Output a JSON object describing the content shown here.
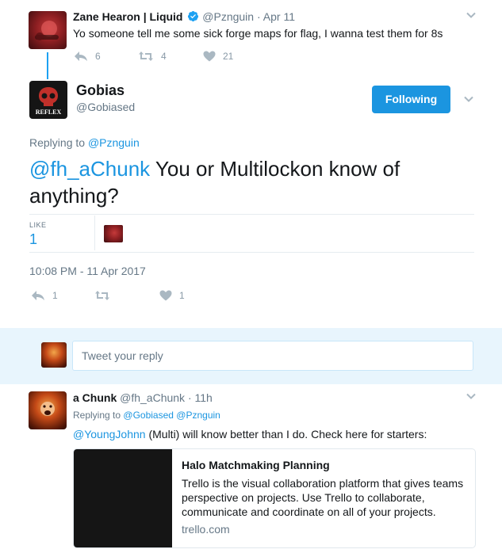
{
  "parent_tweet": {
    "name": "Zane Hearon | Liquid",
    "handle": "@Pznguin",
    "separator": "·",
    "date": "Apr 11",
    "text": "Yo someone tell me some sick forge maps for flag, I wanna test them for 8s",
    "reply_count": "6",
    "retweet_count": "4",
    "like_count": "21"
  },
  "main_tweet": {
    "name": "Gobias",
    "handle": "@Gobiased",
    "avatar_text": "REFLEX",
    "follow_label": "Following",
    "replying_prefix": "Replying to",
    "replying_to": "@Pznguin",
    "mention": "@fh_aChunk",
    "text": " You or Multilockon know of anything?",
    "like_label": "LIKE",
    "like_value": "1",
    "timestamp": "10:08 PM - 11 Apr 2017",
    "reply_count": "1",
    "like_count": "1"
  },
  "reply_box": {
    "placeholder": "Tweet your reply"
  },
  "reply_tweet": {
    "name": "a Chunk",
    "handle": "@fh_aChunk",
    "separator": "·",
    "date": "11h",
    "replying_prefix": "Replying to",
    "replying_to_1": "@Gobiased",
    "replying_to_2": "@Pznguin",
    "mention": "@YoungJohnn",
    "text": " (Multi) will know better than I do. Check here for starters:",
    "card": {
      "title": "Halo Matchmaking Planning",
      "description": "Trello is the visual collaboration platform that gives teams perspective on projects. Use Trello to collaborate, communicate and coordinate on all of your projects.",
      "domain": "trello.com"
    }
  },
  "colors": {
    "accent": "#1b95e0",
    "muted": "#657786",
    "icon": "#aab8c2",
    "reply_band": "#e8f5fd"
  }
}
